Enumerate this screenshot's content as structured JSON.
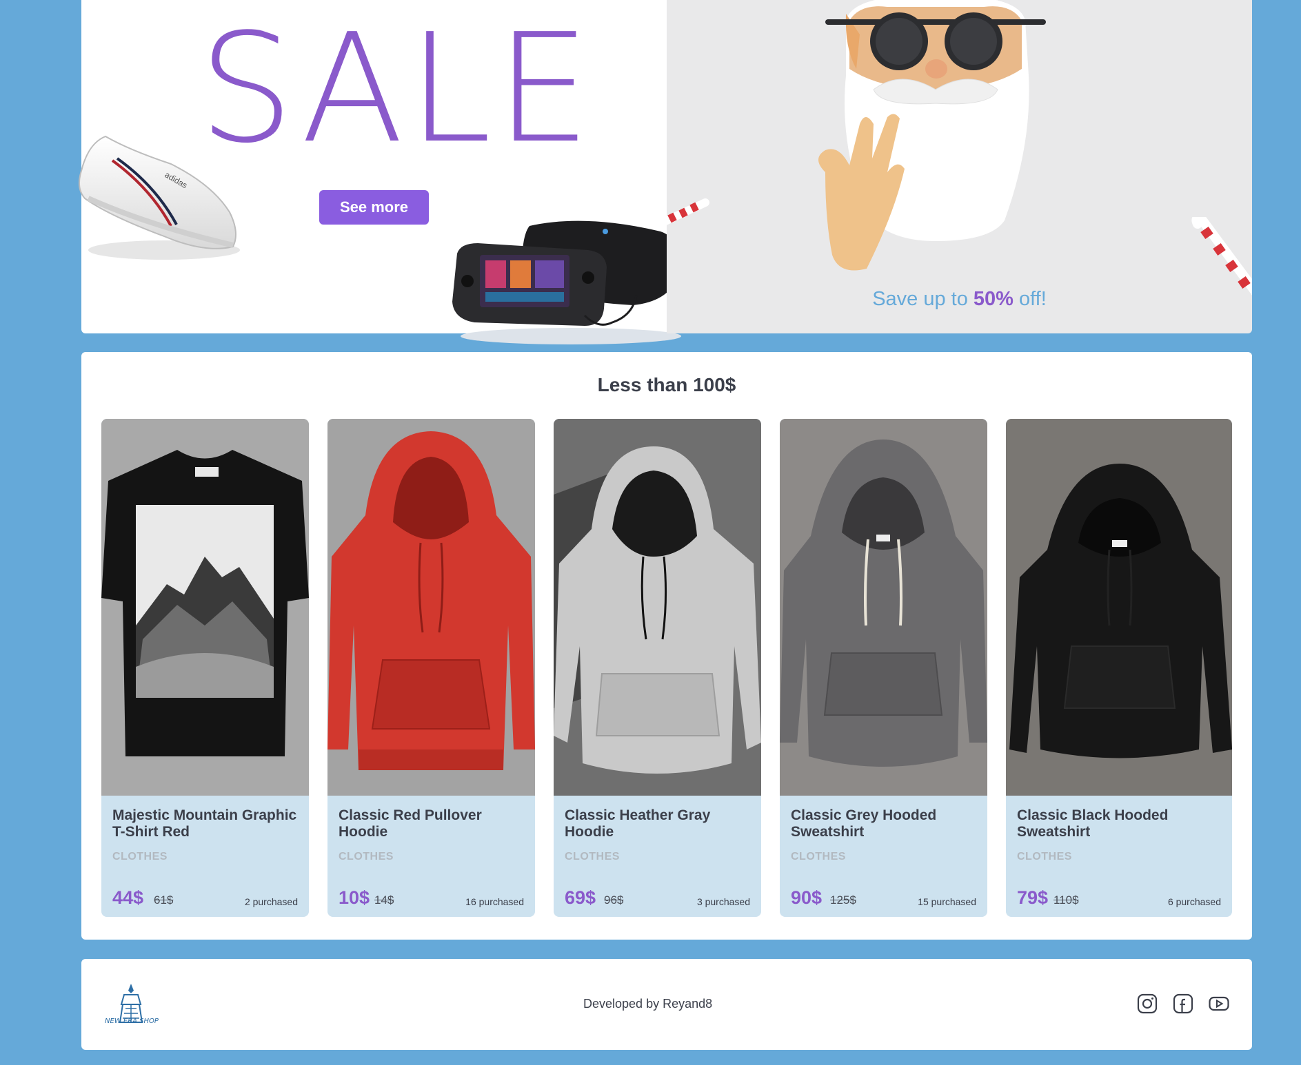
{
  "banner": {
    "sale_title": "SALE",
    "see_more_label": "See more",
    "save_prefix": "Save up to ",
    "save_highlight": "50%",
    "save_suffix": " off!"
  },
  "section": {
    "title": "Less than 100$"
  },
  "products": [
    {
      "name": "Majestic Mountain Graphic T-Shirt Red",
      "category": "CLOTHES",
      "price": "44$",
      "old_price": "61$",
      "purchased": "2 purchased"
    },
    {
      "name": "Classic Red Pullover Hoodie",
      "category": "CLOTHES",
      "price": "10$",
      "old_price": "14$",
      "purchased": "16 purchased"
    },
    {
      "name": "Classic Heather Gray Hoodie",
      "category": "CLOTHES",
      "price": "69$",
      "old_price": "96$",
      "purchased": "3 purchased"
    },
    {
      "name": "Classic Grey Hooded Sweatshirt",
      "category": "CLOTHES",
      "price": "90$",
      "old_price": "125$",
      "purchased": "15 purchased"
    },
    {
      "name": "Classic Black Hooded Sweatshirt",
      "category": "CLOTHES",
      "price": "79$",
      "old_price": "110$",
      "purchased": "6 purchased"
    }
  ],
  "footer": {
    "logo_text": "NEW ERA SHOP",
    "developer_text": "Developed by Reyand8",
    "social_icons": [
      "instagram-icon",
      "facebook-icon",
      "youtube-icon"
    ]
  },
  "colors": {
    "page_background": "#65a9d9",
    "accent_purple": "#8a5acb",
    "card_background": "#cde2ef"
  }
}
